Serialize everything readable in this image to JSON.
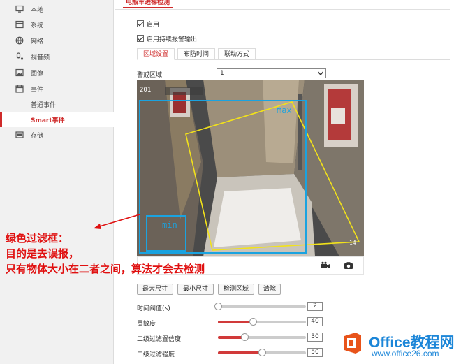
{
  "sidebar": {
    "items": [
      {
        "label": "本地",
        "icon": "monitor-icon"
      },
      {
        "label": "系统",
        "icon": "system-icon"
      },
      {
        "label": "网络",
        "icon": "network-icon"
      },
      {
        "label": "视音频",
        "icon": "microphone-icon"
      },
      {
        "label": "图像",
        "icon": "image-icon"
      },
      {
        "label": "事件",
        "icon": "calendar-icon"
      }
    ],
    "sub_items": [
      {
        "label": "普通事件"
      },
      {
        "label": "Smart事件",
        "active": true
      }
    ],
    "storage": {
      "label": "存储",
      "icon": "storage-icon"
    }
  },
  "main": {
    "page_tab": "电瓶车进梯检测",
    "enable_label": "启用",
    "enable_checked": true,
    "continuous_label": "启用持续报警输出",
    "continuous_checked": true,
    "tabs": [
      {
        "label": "区域设置",
        "active": true
      },
      {
        "label": "布防时间",
        "active": false
      },
      {
        "label": "联动方式",
        "active": false
      }
    ],
    "region_label": "警戒区域",
    "region_value": "1",
    "video": {
      "osd_timestamp": "201",
      "max_label": "max",
      "min_label": "min",
      "corner_text": "14"
    },
    "buttons": {
      "max_size": "最大尺寸",
      "min_size": "最小尺寸",
      "detect_region": "检测区域",
      "clear": "清除"
    },
    "params": [
      {
        "label": "时间阈值(s)",
        "value": "2",
        "fraction": 0.0
      },
      {
        "label": "灵敏度",
        "value": "40",
        "fraction": 0.4
      },
      {
        "label": "二级过滤置信度",
        "value": "30",
        "fraction": 0.3
      },
      {
        "label": "二级过滤强度",
        "value": "50",
        "fraction": 0.5
      }
    ]
  },
  "annotation": {
    "line1": "绿色过滤框：",
    "line2": "目的是去误报，",
    "line3": "只有物体大小在二者之间，算法才会去检测"
  },
  "watermark": {
    "title": "Office教程网",
    "url": "www.office26.com"
  },
  "colors": {
    "accent": "#cf2a2a",
    "annotation": "#e01010",
    "filter_box": "#1aa3e0",
    "detection_area": "#f2e21a",
    "watermark": "#1c86d8"
  }
}
